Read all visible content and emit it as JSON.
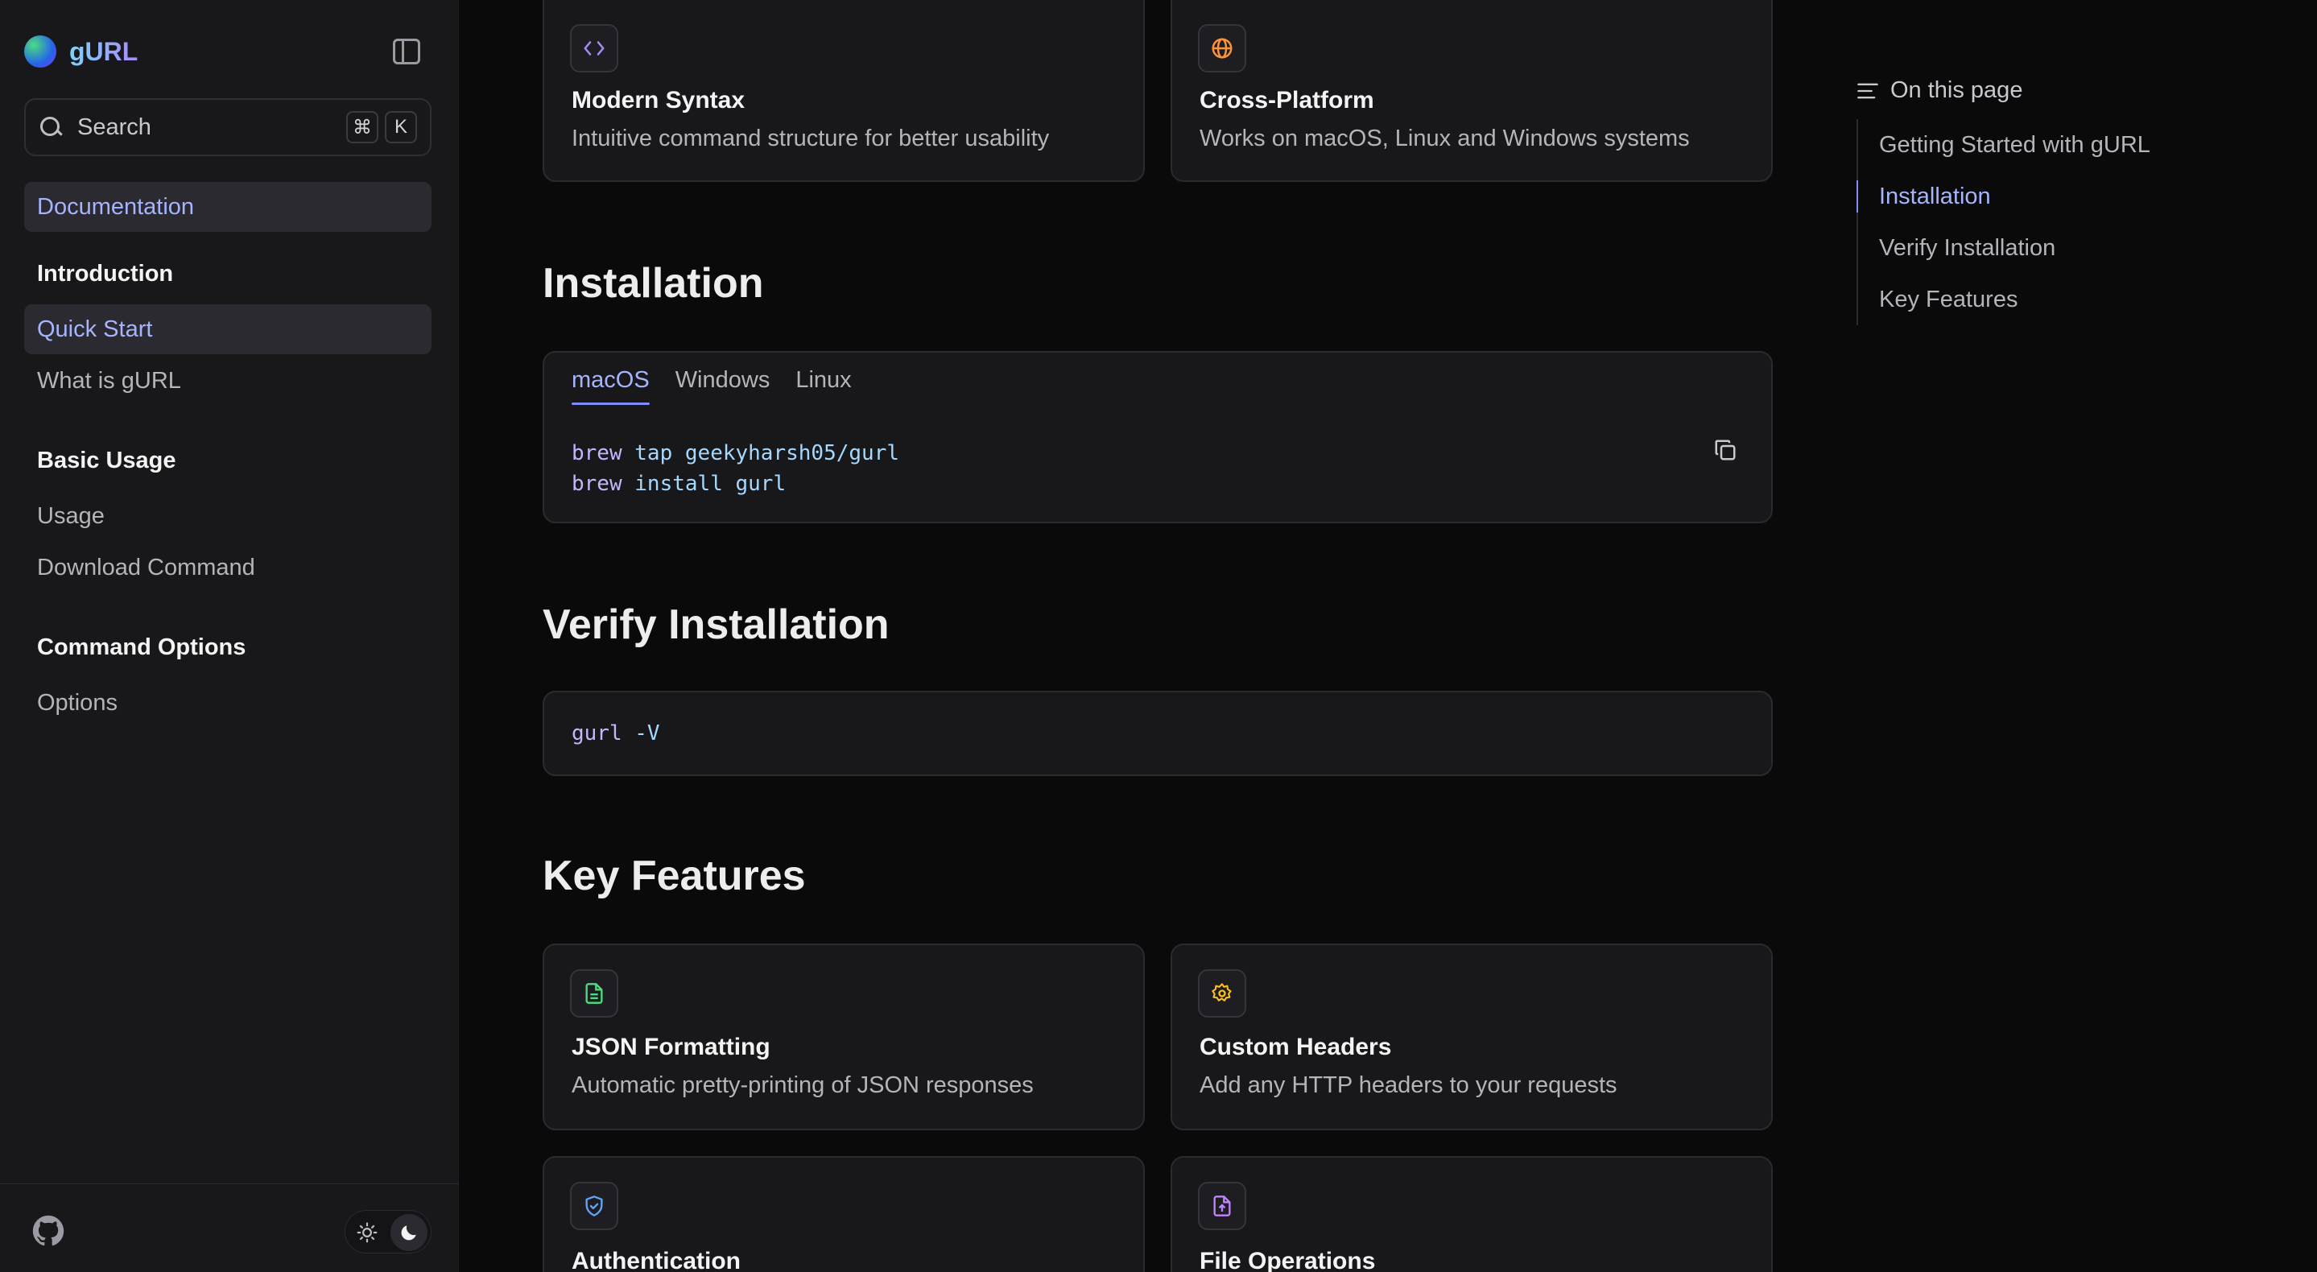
{
  "brand": {
    "name": "gURL"
  },
  "search": {
    "placeholder": "Search",
    "key_modifier": "⌘",
    "key_letter": "K"
  },
  "sidebar": {
    "documentation": "Documentation",
    "sections": [
      {
        "title": "Introduction",
        "items": [
          "Quick Start",
          "What is gURL"
        ]
      },
      {
        "title": "Basic Usage",
        "items": [
          "Usage",
          "Download Command"
        ]
      },
      {
        "title": "Command Options",
        "items": [
          "Options"
        ]
      }
    ],
    "active_item": "Quick Start"
  },
  "top_cards": [
    {
      "icon": "code-icon",
      "title": "Modern Syntax",
      "description": "Intuitive command structure for better usability"
    },
    {
      "icon": "globe-icon",
      "title": "Cross-Platform",
      "description": "Works on macOS, Linux and Windows systems"
    }
  ],
  "installation": {
    "heading": "Installation",
    "tabs": [
      "macOS",
      "Windows",
      "Linux"
    ],
    "active_tab": "macOS",
    "code_lines": [
      {
        "cmd": "brew",
        "rest": " tap geekyharsh05/gurl"
      },
      {
        "cmd": "brew",
        "rest": " install gurl"
      }
    ]
  },
  "verify": {
    "heading": "Verify Installation",
    "code": {
      "cmd": "gurl",
      "rest": " -V"
    }
  },
  "features": {
    "heading": "Key Features",
    "cards": [
      {
        "icon": "file-text-icon",
        "title": "JSON Formatting",
        "description": "Automatic pretty-printing of JSON responses",
        "color": "#4ade80"
      },
      {
        "icon": "gear-icon",
        "title": "Custom Headers",
        "description": "Add any HTTP headers to your requests",
        "color": "#fbbf24"
      },
      {
        "icon": "shield-check-icon",
        "title": "Authentication",
        "description": "",
        "color": "#60a5fa"
      },
      {
        "icon": "file-upload-icon",
        "title": "File Operations",
        "description": "",
        "color": "#c084fc"
      }
    ]
  },
  "toc": {
    "title": "On this page",
    "items": [
      "Getting Started with gURL",
      "Installation",
      "Verify Installation",
      "Key Features"
    ],
    "active": "Installation"
  },
  "colors": {
    "accent": "#a5b4fc",
    "background": "#0a0a0a",
    "surface": "#18181b"
  }
}
